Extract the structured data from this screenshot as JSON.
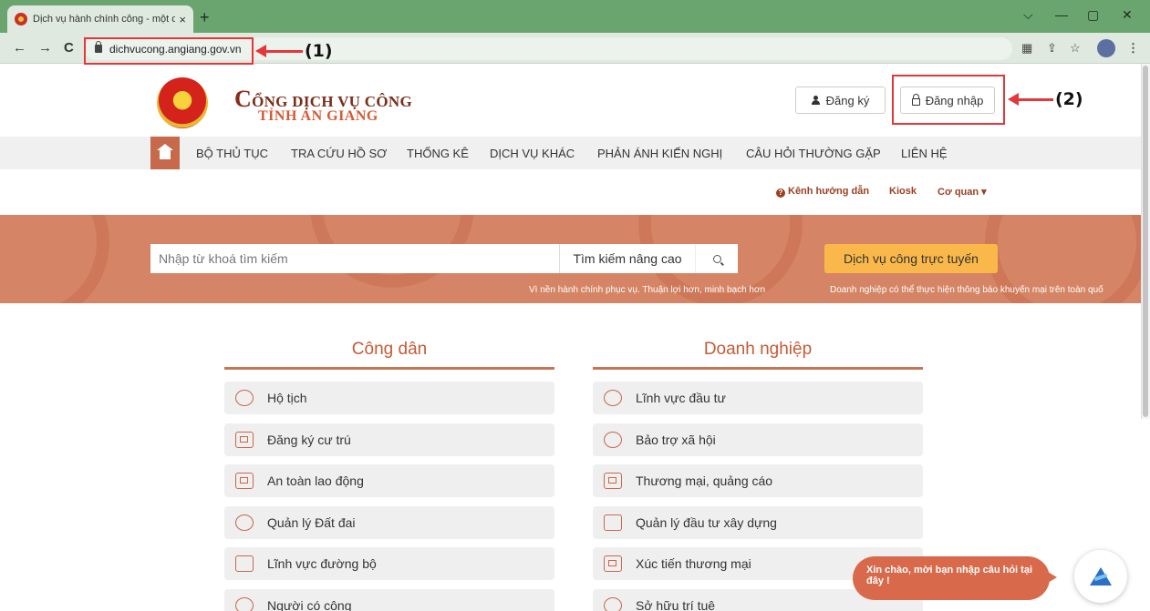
{
  "browser": {
    "tab_title": "Dịch vụ hành chính công - một c",
    "tab_close": "×",
    "new_tab": "+",
    "url": "dichvucong.angiang.gov.vn",
    "win_min": "—",
    "win_max": "▢",
    "win_close": "✕",
    "win_menu": "⌵",
    "back": "←",
    "forward": "→",
    "reload": "C",
    "star": "☆",
    "share": "⇪",
    "translate": "▦",
    "menu_dots": "⋮"
  },
  "annotations": {
    "label1": "(1)",
    "label2": "(2)",
    "color": "#e3373a"
  },
  "header": {
    "brand_first_letter": "C",
    "brand_line1_rest": "ỔNG DỊCH VỤ CÔNG",
    "brand_line2": "TỈNH AN GIANG",
    "register_label": "Đăng ký",
    "login_label": "Đăng nhập"
  },
  "menu": {
    "items": [
      "BỘ THỦ TỤC",
      "TRA CỨU HỒ SƠ",
      "THỐNG KÊ",
      "DỊCH VỤ KHÁC",
      "PHẢN ÁNH KIẾN NGHỊ",
      "CÂU HỎI THƯỜNG GẶP",
      "LIÊN HỆ"
    ]
  },
  "sublinks": {
    "guide": "Kênh hướng dẫn",
    "kiosk": "Kiosk",
    "agency": "Cơ quan ▾"
  },
  "search": {
    "placeholder": "Nhập từ khoá tìm kiếm",
    "advanced_label": "Tìm kiếm nâng cao",
    "online_service_label": "Dịch vụ công trực tuyến"
  },
  "ticker": {
    "item1": "Vì nền hành chính phục vụ. Thuận lợi hơn, minh bạch hơn",
    "item2": "Doanh nghiệp có thể thực hiện thông báo khuyến mại trên toàn quố"
  },
  "citizen": {
    "title": "Công dân",
    "items": [
      "Hộ tịch",
      "Đăng ký cư trú",
      "An toàn lao động",
      "Quản lý Đất đai",
      "Lĩnh vực đường bộ",
      "Người có công"
    ]
  },
  "business": {
    "title": "Doanh nghiệp",
    "items": [
      "Lĩnh vực đầu tư",
      "Bảo trợ xã hội",
      "Thương mại, quảng cáo",
      "Quản lý đầu tư xây dựng",
      "Xúc tiến thương mại",
      "Sở hữu trí tuệ"
    ]
  },
  "chat": {
    "greeting": "Xin chào, mời bạn nhập câu hỏi tại đây !"
  },
  "colors": {
    "accent": "#c7694b",
    "hero": "#d58565",
    "cta": "#fab84a",
    "title_text": "#c65a36"
  }
}
